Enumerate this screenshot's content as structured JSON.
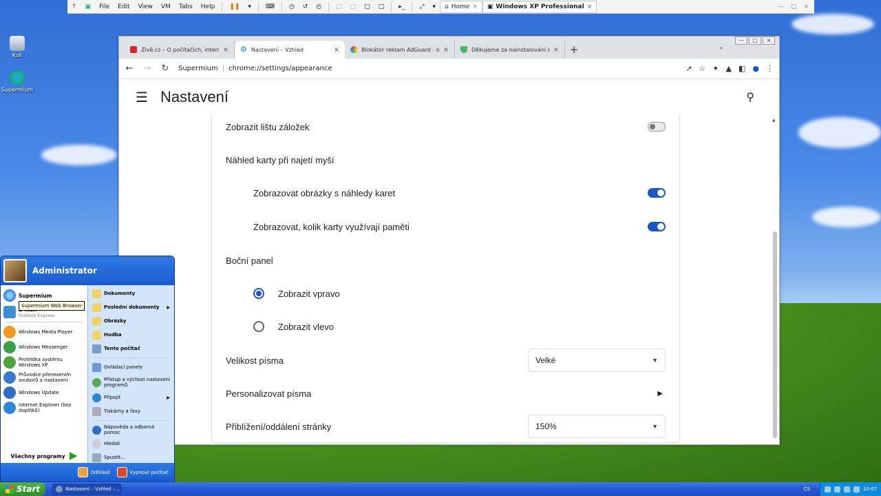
{
  "vm_toolbar": {
    "menus": [
      "File",
      "Edit",
      "View",
      "VM",
      "Tabs",
      "Help"
    ],
    "tabs": [
      {
        "label": "Home",
        "active": false
      },
      {
        "label": "Windows XP Professional",
        "active": true
      }
    ]
  },
  "desktop": {
    "icons": [
      {
        "label": "Koš",
        "icon": "recycle-bin-icon"
      },
      {
        "label": "Supermium",
        "icon": "supermium-icon"
      }
    ]
  },
  "browser": {
    "tabs": [
      {
        "title": "Živě.cz – O počítačích, internetu, v",
        "active": false,
        "favicon_color": "#d9252a"
      },
      {
        "title": "Nastavení – Vzhled",
        "active": true,
        "favicon_color": "#1a73e8"
      },
      {
        "title": "Blokátor reklam AdGuard - Interne",
        "active": false,
        "favicon_color": "#e8a33d"
      },
      {
        "title": "Děkujeme za nainstalování AdGuar",
        "active": false,
        "favicon_color": "#45b863"
      }
    ],
    "new_tab": "+",
    "address": {
      "host": "Supermium",
      "separator": "|",
      "path": "chrome://settings/appearance"
    },
    "settings": {
      "title": "Nastavení",
      "rows": {
        "bookmarks_bar": {
          "label": "Zobrazit lištu záložek",
          "enabled": false
        },
        "tab_hover": {
          "label": "Náhled karty při najetí myší"
        },
        "tab_images": {
          "label": "Zobrazovat obrázky s náhledy karet",
          "enabled": true
        },
        "tab_memory": {
          "label": "Zobrazovat, kolik karty využívají paměti",
          "enabled": true
        },
        "side_panel": {
          "label": "Boční panel"
        },
        "side_right": {
          "label": "Zobrazit vpravo",
          "selected": true
        },
        "side_left": {
          "label": "Zobrazit vlevo",
          "selected": false
        },
        "font_size": {
          "label": "Velikost písma",
          "value": "Velké"
        },
        "custom_fonts": {
          "label": "Personalizovat písma"
        },
        "zoom": {
          "label": "Přiblížení/oddálení stránky",
          "value": "150%"
        }
      }
    },
    "accent_color": "#1a56c4"
  },
  "start_menu": {
    "user": "Administrator",
    "pinned": [
      {
        "name": "Supermium",
        "sub": "",
        "color": "#2a7ad8"
      },
      {
        "name": "E-mail",
        "sub": "Outlook Express",
        "color": "#3b8fd6"
      }
    ],
    "tooltip": "Supermium Web Browser",
    "recent": [
      {
        "name": "Windows Media Player",
        "color": "#f29b1a"
      },
      {
        "name": "Windows Messenger",
        "color": "#3aa04a"
      },
      {
        "name": "Prohlídka systému Windows XP",
        "color": "#4aa63a"
      },
      {
        "name": "Průvodce přenesením souborů a nastavení",
        "color": "#3a7acc"
      },
      {
        "name": "Windows Update",
        "color": "#2f6dc9"
      },
      {
        "name": "Internet Explorer (bez doplňků)",
        "color": "#2d87d8"
      }
    ],
    "all_programs": "Všechny programy",
    "right": [
      {
        "name": "Dokumenty",
        "bold": true,
        "arrow": false
      },
      {
        "name": "Poslední dokumenty",
        "bold": true,
        "arrow": true
      },
      {
        "name": "Obrázky",
        "bold": true,
        "arrow": false
      },
      {
        "name": "Hudba",
        "bold": true,
        "arrow": false
      },
      {
        "name": "Tento počítač",
        "bold": true,
        "arrow": false
      },
      {
        "name": "Ovládací panely",
        "bold": false,
        "arrow": false
      },
      {
        "name": "Přístup a výchozí nastavení programů",
        "bold": false,
        "arrow": false
      },
      {
        "name": "Připojit",
        "bold": false,
        "arrow": true
      },
      {
        "name": "Tiskárny a faxy",
        "bold": false,
        "arrow": false
      },
      {
        "name": "Nápověda a odborná pomoc",
        "bold": false,
        "arrow": false
      },
      {
        "name": "Hledat",
        "bold": false,
        "arrow": false
      },
      {
        "name": "Spustit...",
        "bold": false,
        "arrow": false
      }
    ],
    "logoff": "Odhlásit",
    "shutdown": "Vypnout počítač"
  },
  "taskbar": {
    "start": "Start",
    "item": "Nastavení – Vzhled – ...",
    "language": "CS",
    "time": "10:07"
  }
}
